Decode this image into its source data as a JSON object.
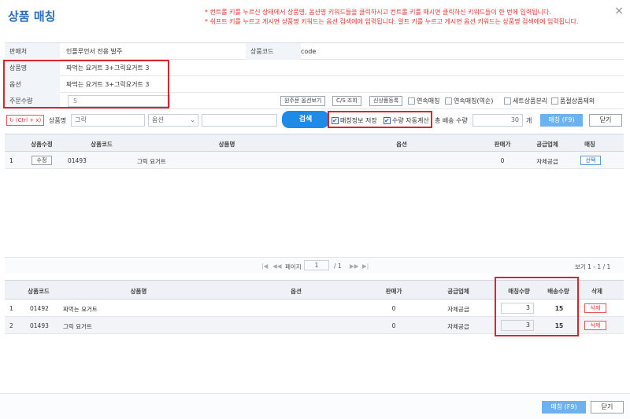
{
  "window": {
    "title": "상품 매칭",
    "close_icon": "×",
    "notices": [
      "* 컨트롤 키를 누르신 상태에서 상품명, 옵션명 키워드들을 클릭하시고 컨트롤 키를 때시면 클릭하신 키워드들이 한 번에 입력됩니다.",
      "* 쉬프트 키를 누르고 게시면 상품명 키워드는 옵션 검색에에 입력됩니다. 알트 키를 누르고 게시면 옵션 키워드는 상품명 검색에에 입력됩니다."
    ]
  },
  "info": {
    "seller_label": "판매처",
    "seller_value": "인플루언서 전용 발주",
    "product_code_label": "상품코드",
    "product_code_value": "code",
    "product_name_label": "상품명",
    "product_name_value": "짜먹는 요거트 3+그릭요거트 3",
    "option_label": "옵션",
    "option_value": "짜먹는 요거트 3+그릭요거트 3",
    "order_qty_label": "주문수량",
    "order_qty_value": "5",
    "btn_view_option": "원주문 옵션보기",
    "btn_cs": "C/S 조회",
    "btn_new_product": "신상품등록",
    "chk_continuous": "연속매칭",
    "chk_continuous_reverse": "연속매칭(역순)",
    "chk_set_split": "세트상품분리",
    "chk_exclude_soldout": "품절상품제외"
  },
  "search": {
    "ctrl_x_label": "(Ctrl + x)",
    "product_name_label": "상품명",
    "product_name_value": "그릭",
    "option_placeholder": "옵션",
    "search_button": "검색",
    "chk_save_match": "매칭정보 저장",
    "chk_auto_qty": "수량 자동계산",
    "total_qty_label": "총 배송 수량",
    "total_qty_value": "30",
    "unit": "개",
    "match_button": "매칭 (F9)",
    "close_button": "닫기"
  },
  "top_grid": {
    "headers": [
      "상품수정",
      "상품코드",
      "상품명",
      "옵션",
      "판매가",
      "공급업체",
      "매칭"
    ],
    "rows": [
      {
        "no": "1",
        "edit": "수정",
        "code": "01493",
        "name": "그릭 요거트",
        "option": "",
        "price": "0",
        "supplier": "자체공급",
        "action": "선택"
      }
    ],
    "pager": {
      "first": "|◀",
      "prev": "◀◀",
      "page_label": "페이지",
      "page_value": "1",
      "of": "/ 1",
      "next": "▶▶",
      "last": "▶|",
      "summary": "보기 1 - 1 / 1"
    }
  },
  "bottom_grid": {
    "headers": [
      "상품코드",
      "상품명",
      "옵션",
      "판매가",
      "공급업체",
      "매칭수량",
      "배송수량",
      "삭제"
    ],
    "rows": [
      {
        "no": "1",
        "code": "01492",
        "name": "짜먹는 요거트",
        "option": "",
        "price": "0",
        "supplier": "자체공급",
        "match_qty": "3",
        "ship_qty": "15",
        "delete": "삭제"
      },
      {
        "no": "2",
        "code": "01493",
        "name": "그릭 요거트",
        "option": "",
        "price": "0",
        "supplier": "자체공급",
        "match_qty": "3",
        "ship_qty": "15",
        "delete": "삭제"
      }
    ]
  },
  "footer": {
    "match_button": "매칭 (F9)",
    "close_button": "닫기"
  },
  "colors": {
    "accent": "#1e8be8",
    "title": "#2b6cc4",
    "notice": "#e33333",
    "highlight_box": "#d9262c"
  }
}
